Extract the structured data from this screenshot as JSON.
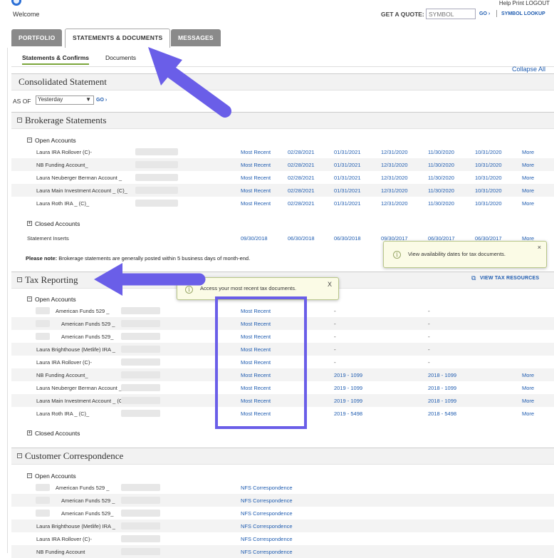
{
  "header": {
    "welcome": "Welcome",
    "top_links": "Help  Print  LOGOUT",
    "quote_label": "GET A QUOTE:",
    "quote_placeholder": "SYMBOL",
    "go_label": "GO ›",
    "symbol_lookup": "SYMBOL LOOKUP"
  },
  "tabs": [
    {
      "label": "PORTFOLIO"
    },
    {
      "label": "STATEMENTS & DOCUMENTS"
    },
    {
      "label": "MESSAGES"
    }
  ],
  "subtabs": [
    {
      "label": "Statements & Confirms"
    },
    {
      "label": "Documents"
    }
  ],
  "collapse_all": "Collapse All",
  "consolidated": {
    "title": "Consolidated Statement",
    "as_of_label": "AS OF",
    "as_of_value": "Yesterday",
    "go_label": "GO ›"
  },
  "brokerage": {
    "title": "Brokerage Statements",
    "open_label": "Open Accounts",
    "rows": [
      {
        "name": "Laura IRA Rollover (C)-",
        "recent": "Most Recent",
        "d1": "02/28/2021",
        "d2": "01/31/2021",
        "d3": "12/31/2020",
        "d4": "11/30/2020",
        "d5": "10/31/2020",
        "more": "More"
      },
      {
        "name": "NB Funding Account_",
        "recent": "Most Recent",
        "d1": "02/28/2021",
        "d2": "01/31/2021",
        "d3": "12/31/2020",
        "d4": "11/30/2020",
        "d5": "10/31/2020",
        "more": "More"
      },
      {
        "name": "Laura Neuberger Berman Account _",
        "recent": "Most Recent",
        "d1": "02/28/2021",
        "d2": "01/31/2021",
        "d3": "12/31/2020",
        "d4": "11/30/2020",
        "d5": "10/31/2020",
        "more": "More"
      },
      {
        "name": "Laura Main Investment Account _ (C)_",
        "recent": "Most Recent",
        "d1": "02/28/2021",
        "d2": "01/31/2021",
        "d3": "12/31/2020",
        "d4": "11/30/2020",
        "d5": "10/31/2020",
        "more": "More"
      },
      {
        "name": "Laura Roth IRA _ (C)_",
        "recent": "Most Recent",
        "d1": "02/28/2021",
        "d2": "01/31/2021",
        "d3": "12/31/2020",
        "d4": "11/30/2020",
        "d5": "10/31/2020",
        "more": "More"
      }
    ],
    "closed_label": "Closed Accounts",
    "inserts": {
      "name": "Statement Inserts",
      "d1": "09/30/2018",
      "d2": "06/30/2018",
      "d3": "06/30/2018",
      "d4": "09/30/2017",
      "d5": "06/30/2017",
      "d6": "06/30/2017",
      "more": "More"
    },
    "note_bold": "Please note:",
    "note_text": " Brokerage statements are generally posted within 5 business days of month-end."
  },
  "tooltip_availability": {
    "text": "View availability dates for tax documents.",
    "close": "×"
  },
  "tooltip_recent": {
    "text": "Access your most recent tax documents.",
    "close": "X"
  },
  "tax": {
    "title": "Tax Reporting",
    "view_resources": "VIEW TAX RESOURCES",
    "open_label": "Open Accounts",
    "rows": [
      {
        "name": "American Funds 529 _",
        "recent": "Most Recent",
        "c1": "-",
        "c2": "-",
        "more": ""
      },
      {
        "name": "American Funds 529 _",
        "recent": "Most Recent",
        "c1": "-",
        "c2": "-",
        "more": ""
      },
      {
        "name": "American Funds 529_",
        "recent": "Most Recent",
        "c1": "-",
        "c2": "-",
        "more": ""
      },
      {
        "name": "Laura Brighthouse (Metlife) IRA _",
        "recent": "Most Recent",
        "c1": "-",
        "c2": "-",
        "more": ""
      },
      {
        "name": "Laura IRA Rollover (C)-",
        "recent": "Most Recent",
        "c1": "-",
        "c2": "-",
        "more": ""
      },
      {
        "name": "NB Funding Account_",
        "recent": "Most Recent",
        "c1": "2019 - 1099",
        "c2": "2018 - 1099",
        "more": "More"
      },
      {
        "name": "Laura Neuberger Berman Account _",
        "recent": "Most Recent",
        "c1": "2019 - 1099",
        "c2": "2018 - 1099",
        "more": "More"
      },
      {
        "name": "Laura Main Investment Account _ (C)_",
        "recent": "Most Recent",
        "c1": "2019 - 1099",
        "c2": "2018 - 1099",
        "more": "More"
      },
      {
        "name": "Laura Roth IRA _ (C)_",
        "recent": "Most Recent",
        "c1": "2019 - 5498",
        "c2": "2018 - 5498",
        "more": "More"
      }
    ],
    "closed_label": "Closed Accounts"
  },
  "correspondence": {
    "title": "Customer Correspondence",
    "open_label": "Open Accounts",
    "rows": [
      {
        "name": "American Funds 529 _",
        "link": "NFS Correspondence"
      },
      {
        "name": "American Funds 529 _",
        "link": "NFS Correspondence"
      },
      {
        "name": "American Funds 529_",
        "link": "NFS Correspondence"
      },
      {
        "name": "Laura Brighthouse (Metlife) IRA _",
        "link": "NFS Correspondence"
      },
      {
        "name": "Laura IRA Rollover (C)-",
        "link": "NFS Correspondence"
      },
      {
        "name": "NB Funding Account",
        "link": "NFS Correspondence"
      }
    ]
  },
  "colors": {
    "annotation": "#6a5ee8",
    "link": "#1f5cb0",
    "tab_inactive": "#8a8a8a",
    "active_underline": "#7aa53a"
  }
}
